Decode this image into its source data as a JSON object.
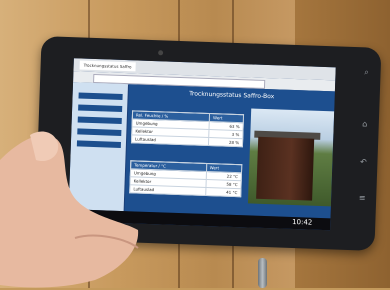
{
  "tab_title": "Trocknungsstatus Saffro",
  "page_title": "Trocknungsstatus Saffro-Box",
  "table_humidity": {
    "headers": [
      "Rel. Feuchte / %",
      "Wert"
    ],
    "rows": [
      {
        "label": "Umgebung",
        "value": "63 %"
      },
      {
        "label": "Kellektor",
        "value": "3 %"
      },
      {
        "label": "Luftauslad",
        "value": "28 %"
      }
    ]
  },
  "table_temperature": {
    "headers": [
      "Temperatur / °C",
      "Wert"
    ],
    "rows": [
      {
        "label": "Umgebung",
        "value": "22 °C"
      },
      {
        "label": "Kellektor",
        "value": "58 °C"
      },
      {
        "label": "Luftauslad",
        "value": "41 °C"
      }
    ]
  },
  "status_time": "10:42"
}
